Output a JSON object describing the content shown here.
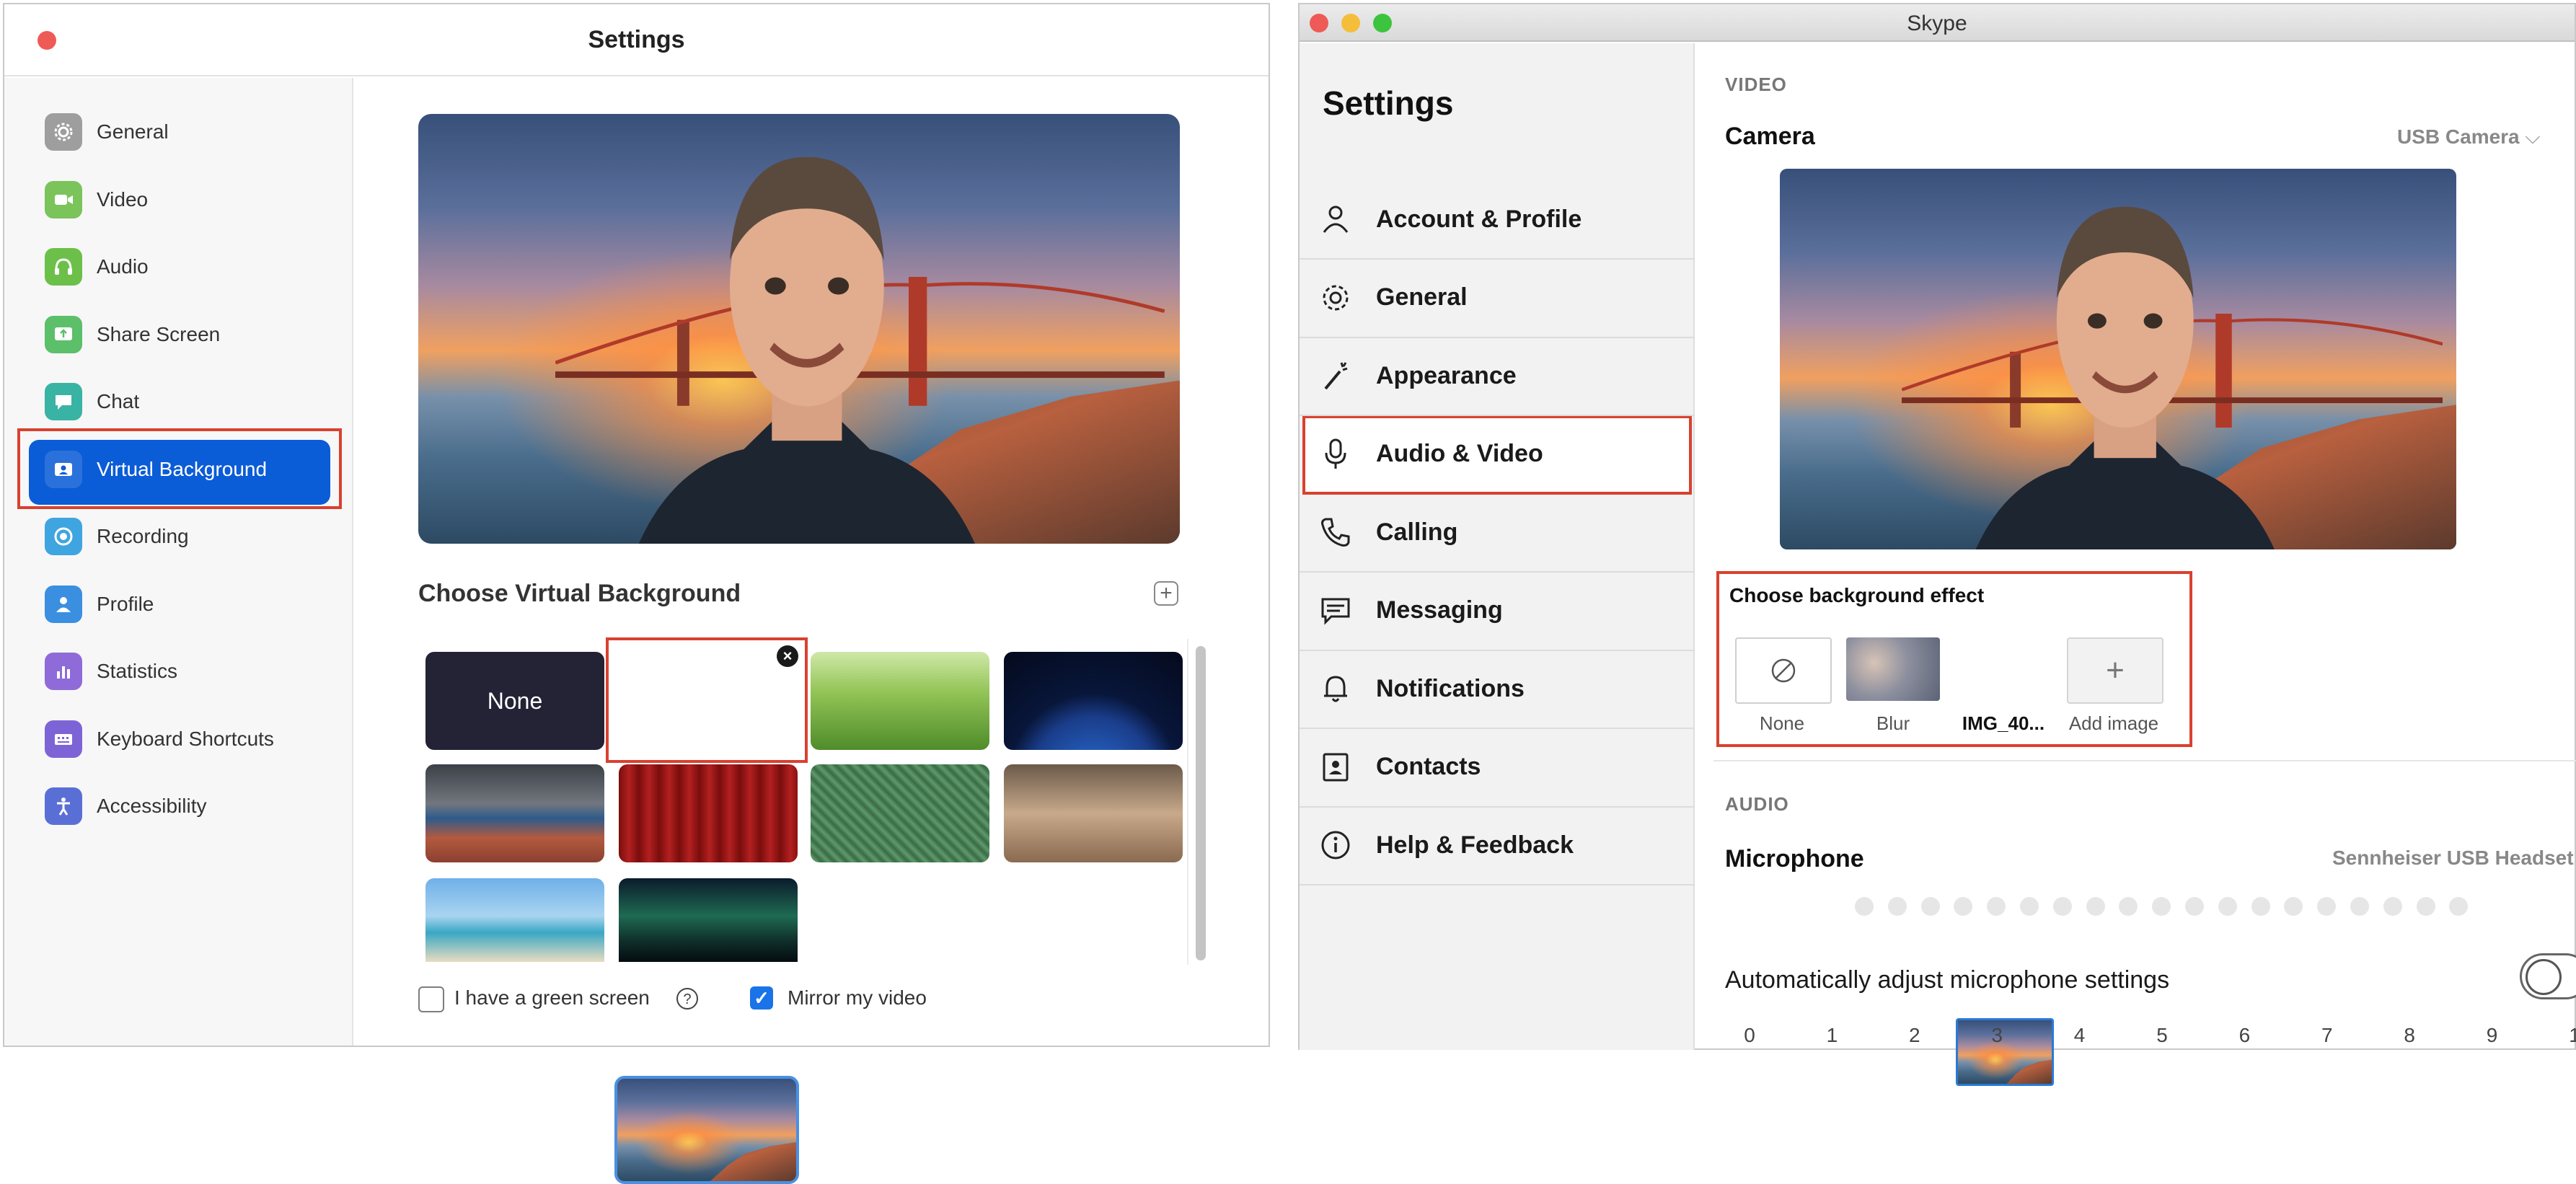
{
  "zoom": {
    "title": "Settings",
    "sidebar": [
      {
        "label": "General",
        "icon": "gear-icon",
        "color": "#9e9e9e"
      },
      {
        "label": "Video",
        "icon": "video-camera-icon",
        "color": "#7ac45b"
      },
      {
        "label": "Audio",
        "icon": "headphones-icon",
        "color": "#6cc04a"
      },
      {
        "label": "Share Screen",
        "icon": "share-screen-icon",
        "color": "#5cbf6a"
      },
      {
        "label": "Chat",
        "icon": "chat-bubble-icon",
        "color": "#39b3a4"
      },
      {
        "label": "Virtual Background",
        "icon": "virtual-background-icon",
        "color": "#0b5cd7",
        "selected": true
      },
      {
        "label": "Recording",
        "icon": "record-icon",
        "color": "#3fa5e0"
      },
      {
        "label": "Profile",
        "icon": "person-icon",
        "color": "#3b8fe0"
      },
      {
        "label": "Statistics",
        "icon": "bar-chart-icon",
        "color": "#8e6bd8"
      },
      {
        "label": "Keyboard Shortcuts",
        "icon": "keyboard-icon",
        "color": "#7c64d6"
      },
      {
        "label": "Accessibility",
        "icon": "accessibility-icon",
        "color": "#5a6fd6"
      }
    ],
    "choose_label": "Choose Virtual Background",
    "none_label": "None",
    "green_screen_label": "I have a green screen",
    "green_screen_checked": false,
    "mirror_label": "Mirror my video",
    "mirror_checked": true
  },
  "skype": {
    "window_title": "Skype",
    "settings_title": "Settings",
    "nav": [
      {
        "label": "Account & Profile",
        "icon": "person-outline-icon"
      },
      {
        "label": "General",
        "icon": "gear-outline-icon"
      },
      {
        "label": "Appearance",
        "icon": "magic-wand-icon"
      },
      {
        "label": "Audio & Video",
        "icon": "microphone-icon",
        "selected": true
      },
      {
        "label": "Calling",
        "icon": "phone-icon"
      },
      {
        "label": "Messaging",
        "icon": "message-icon"
      },
      {
        "label": "Notifications",
        "icon": "bell-icon"
      },
      {
        "label": "Contacts",
        "icon": "contacts-icon"
      },
      {
        "label": "Help & Feedback",
        "icon": "info-icon"
      }
    ],
    "video_section": "VIDEO",
    "camera_label": "Camera",
    "camera_value": "USB Camera",
    "effect_title": "Choose background effect",
    "effects": [
      {
        "label": "None"
      },
      {
        "label": "Blur"
      },
      {
        "label": "IMG_40...",
        "selected": true
      },
      {
        "label": "Add image"
      }
    ],
    "audio_section": "AUDIO",
    "mic_label": "Microphone",
    "mic_value": "Sennheiser USB Headset",
    "auto_adjust_label": "Automatically adjust microphone settings",
    "auto_adjust_on": false,
    "volume_scale": [
      "0",
      "1",
      "2",
      "3",
      "4",
      "5",
      "6",
      "7",
      "8",
      "9",
      "1"
    ]
  },
  "colors": {
    "highlight_red": "#d9412f",
    "zoom_blue": "#0b5cd7"
  }
}
